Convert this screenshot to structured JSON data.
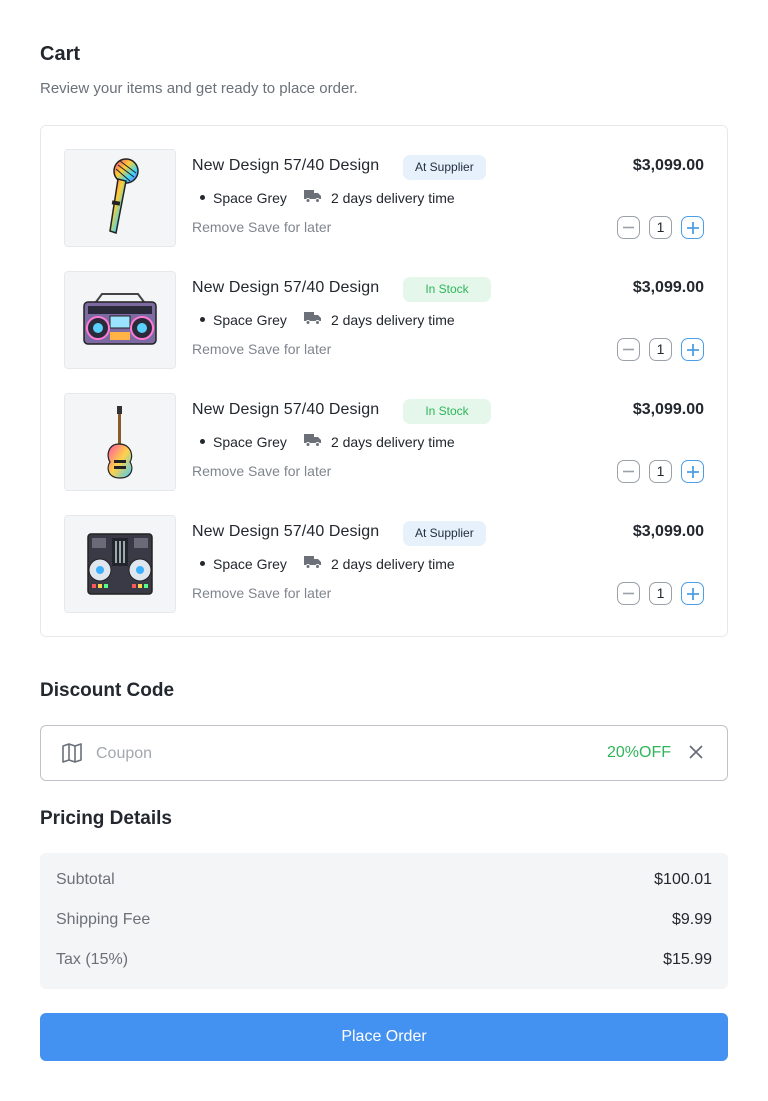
{
  "page": {
    "title": "Cart",
    "subtitle": "Review your items and get ready to place order."
  },
  "cart": {
    "items": [
      {
        "name": "New Design 57/40 Design",
        "badge": "At Supplier",
        "badge_type": "supplier",
        "color": "Space Grey",
        "delivery": "2 days delivery time",
        "remove_label": "Remove",
        "save_label": "Save for later",
        "price": "$3,099.00",
        "quantity": "1",
        "image": "microphone-image"
      },
      {
        "name": "New Design 57/40 Design",
        "badge": "In Stock",
        "badge_type": "stock",
        "color": "Space Grey",
        "delivery": "2 days delivery time",
        "remove_label": "Remove",
        "save_label": "Save for later",
        "price": "$3,099.00",
        "quantity": "1",
        "image": "boombox-image"
      },
      {
        "name": "New Design 57/40 Design",
        "badge": "In Stock",
        "badge_type": "stock",
        "color": "Space Grey",
        "delivery": "2 days delivery time",
        "remove_label": "Remove",
        "save_label": "Save for later",
        "price": "$3,099.00",
        "quantity": "1",
        "image": "guitar-image"
      },
      {
        "name": "New Design 57/40 Design",
        "badge": "At Supplier",
        "badge_type": "supplier",
        "color": "Space Grey",
        "delivery": "2 days delivery time",
        "remove_label": "Remove",
        "save_label": "Save for later",
        "price": "$3,099.00",
        "quantity": "1",
        "image": "dj-controller-image"
      }
    ]
  },
  "discount": {
    "title": "Discount Code",
    "placeholder": "Coupon",
    "value": "",
    "applied_label": "20%OFF"
  },
  "pricing": {
    "title": "Pricing Details",
    "rows": [
      {
        "label": "Subtotal",
        "value": "$100.01"
      },
      {
        "label": "Shipping Fee",
        "value": "$9.99"
      },
      {
        "label": "Tax (15%)",
        "value": "$15.99"
      }
    ]
  },
  "checkout": {
    "button_label": "Place Order"
  },
  "colors": {
    "accent": "#4391f1",
    "success": "#2fb55a",
    "supplier_badge_bg": "#e7f1fb",
    "stock_badge_bg": "#e5f7ea"
  }
}
